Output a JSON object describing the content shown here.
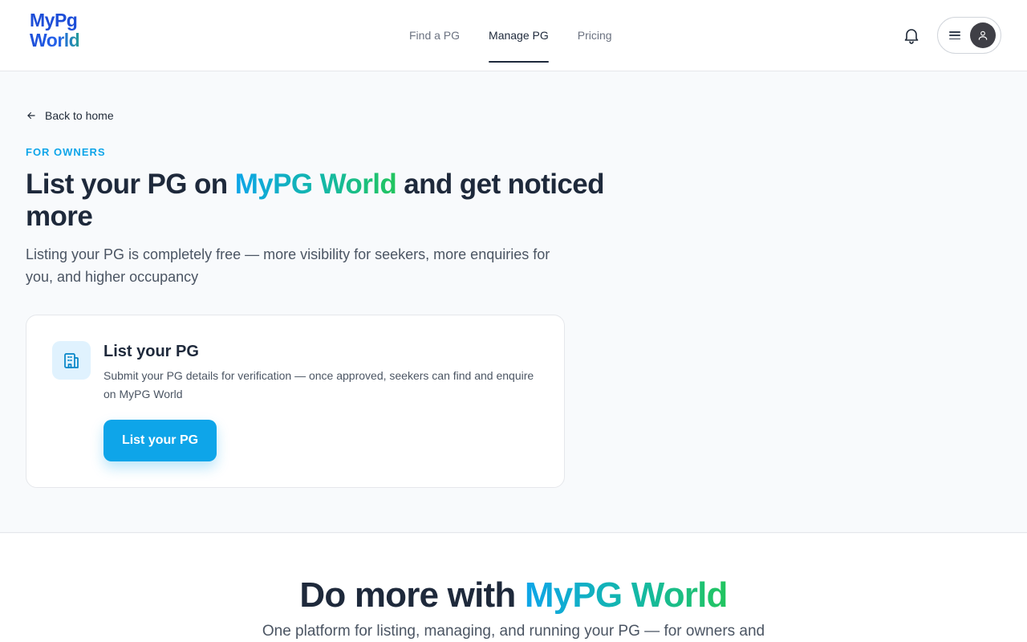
{
  "header": {
    "logo_line1": "MyPg",
    "logo_line2": "World",
    "nav": [
      {
        "label": "Find a PG"
      },
      {
        "label": "Manage PG"
      },
      {
        "label": "Pricing"
      }
    ],
    "active_nav": "Manage PG"
  },
  "hero": {
    "back_label": "Back to home",
    "eyebrow": "FOR OWNERS",
    "headline_pre": "List your PG on ",
    "headline_brand": "MyPG World",
    "headline_post": " and get noticed more",
    "subtitle": "Listing your PG is completely free — more visibility for seekers, more enquiries for you, and higher occupancy"
  },
  "card": {
    "icon": "building-icon",
    "title": "List your PG",
    "description": "Submit your PG details for verification — once approved, seekers can find and enquire on MyPG World",
    "button_label": "List your PG"
  },
  "section": {
    "title_pre": "Do more with ",
    "title_brand": "MyPG World",
    "subtitle": "One platform for listing, managing, and running your PG — for owners and"
  },
  "colors": {
    "accent": "#0ea5e9",
    "brand_gradient_start": "#0ea5e9",
    "brand_gradient_end": "#22c55e",
    "text_dark": "#1e293b"
  }
}
